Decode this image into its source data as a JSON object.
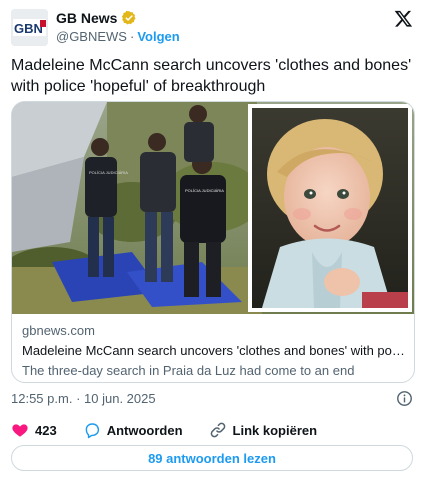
{
  "author": {
    "name": "GB News",
    "handle": "@GBNEWS",
    "separator": "·",
    "follow_label": "Volgen",
    "avatar_logo_text": "GBN"
  },
  "tweet": {
    "text": "Madeleine McCann search uncovers 'clothes and bones' with police 'hopeful' of breakthrough"
  },
  "link_card": {
    "domain": "gbnews.com",
    "title": "Madeleine McCann search uncovers 'clothes and bones' with police 'hop...",
    "description": "The three-day search in Praia da Luz had come to an end",
    "photo_vest_text_1": "POLÍCIA JUDICIÁRIA",
    "photo_vest_text_2": "POLÍCIA JUDICIÁRIA"
  },
  "timestamp": {
    "time": "12:55 p.m.",
    "separator": "·",
    "date": "10 jun. 2025"
  },
  "actions": {
    "like_count": "423",
    "reply_label": "Antwoorden",
    "copy_link_label": "Link kopiëren"
  },
  "replies_button": {
    "label": "89 antwoorden lezen"
  },
  "colors": {
    "accent": "#1d9bf0",
    "like": "#f91880",
    "verified": "#e2b719",
    "gbnews_blue": "#1a3a6e",
    "gbnews_red": "#c8102e"
  },
  "icons": {
    "verified": "verified-badge-icon",
    "x_logo": "x-logo-icon",
    "info": "info-icon",
    "like": "heart-icon",
    "reply": "reply-bubble-icon",
    "copy_link": "link-icon"
  }
}
